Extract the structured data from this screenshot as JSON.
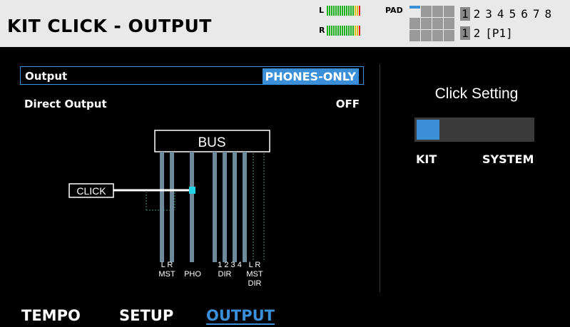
{
  "header": {
    "title": "KIT CLICK - OUTPUT",
    "meter_l": "L",
    "meter_r": "R",
    "pad_label": "PAD",
    "numbers_row1": [
      "1",
      "2",
      "3",
      "4",
      "5",
      "6",
      "7",
      "8"
    ],
    "numbers_row2": [
      "1",
      "2",
      "[P1]"
    ]
  },
  "params": [
    {
      "label": "Output",
      "value": "PHONES-ONLY"
    },
    {
      "label": "Direct Output",
      "value": "OFF"
    }
  ],
  "diagram": {
    "bus_label": "BUS",
    "click_label": "CLICK",
    "lane_labels": {
      "lr1": "L R",
      "mst1": "MST",
      "pho": "PHO",
      "dirnums": "1 2 3 4",
      "dir": "DIR",
      "lr2": "L R",
      "mst2": "MST",
      "dir2": "DIR"
    }
  },
  "click_setting": {
    "title": "Click Setting",
    "level": 0.2,
    "kit": "KIT",
    "system": "SYSTEM"
  },
  "tabs": [
    {
      "label": "TEMPO",
      "active": false
    },
    {
      "label": "SETUP",
      "active": false
    },
    {
      "label": "OUTPUT",
      "active": true
    }
  ],
  "colors": {
    "accent": "#3a8fd8",
    "cyan": "#22d3e6",
    "lane": "#6e8a9c",
    "header": "#e9e9e9"
  }
}
